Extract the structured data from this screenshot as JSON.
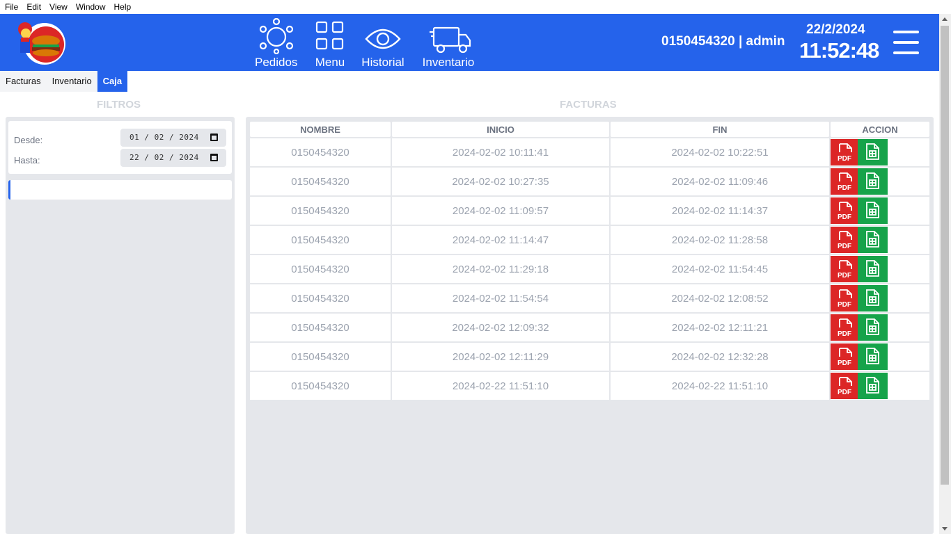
{
  "menubar": [
    "File",
    "Edit",
    "View",
    "Window",
    "Help"
  ],
  "header": {
    "nav": [
      {
        "label": "Pedidos",
        "icon": "table-icon"
      },
      {
        "label": "Menu",
        "icon": "grid-icon"
      },
      {
        "label": "Historial",
        "icon": "eye-icon"
      },
      {
        "label": "Inventario",
        "icon": "truck-icon"
      }
    ],
    "user": "0150454320 | admin",
    "date": "22/2/2024",
    "time": "11:52:48",
    "accent": "#2563eb"
  },
  "tabs": [
    {
      "label": "Facturas",
      "active": false
    },
    {
      "label": "Inventario",
      "active": false
    },
    {
      "label": "Caja",
      "active": true
    }
  ],
  "filters": {
    "title": "FILTROS",
    "desde_label": "Desde:",
    "desde_value": "01/02/2024",
    "hasta_label": "Hasta:",
    "hasta_value": "22/02/2024"
  },
  "facturas": {
    "title": "FACTURAS",
    "columns": [
      "NOMBRE",
      "INICIO",
      "FIN",
      "ACCION"
    ],
    "rows": [
      [
        "0150454320",
        "2024-02-02 10:11:41",
        "2024-02-02 10:22:51"
      ],
      [
        "0150454320",
        "2024-02-02 10:27:35",
        "2024-02-02 11:09:46"
      ],
      [
        "0150454320",
        "2024-02-02 11:09:57",
        "2024-02-02 11:14:37"
      ],
      [
        "0150454320",
        "2024-02-02 11:14:47",
        "2024-02-02 11:28:58"
      ],
      [
        "0150454320",
        "2024-02-02 11:29:18",
        "2024-02-02 11:54:45"
      ],
      [
        "0150454320",
        "2024-02-02 11:54:54",
        "2024-02-02 12:08:52"
      ],
      [
        "0150454320",
        "2024-02-02 12:09:32",
        "2024-02-02 12:11:21"
      ],
      [
        "0150454320",
        "2024-02-02 12:11:29",
        "2024-02-02 12:32:28"
      ],
      [
        "0150454320",
        "2024-02-22 11:51:10",
        "2024-02-22 11:51:10"
      ]
    ],
    "pdf_label": "PDF"
  }
}
